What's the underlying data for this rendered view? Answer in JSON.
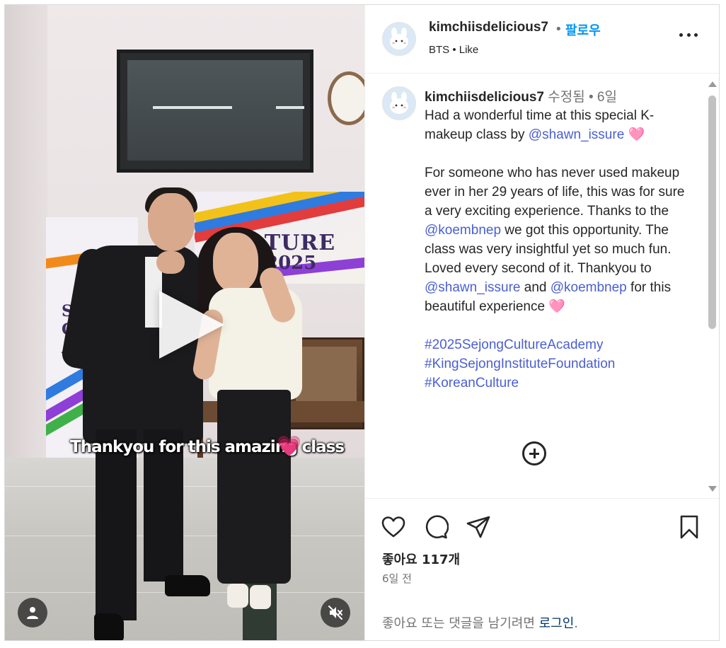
{
  "post": {
    "author": "kimchiisdelicious7",
    "follow_label": "팔로우",
    "subtitle": "BTS • Like",
    "video_caption": "Thankyou for this amazing class",
    "heart_emoji": "💗"
  },
  "comment": {
    "username": "kimchiisdelicious7",
    "meta": "수정됨 • 6일",
    "para1_text": "Had a wonderful time at this special K-makeup class by ",
    "para1_mention": "@shawn_issure",
    "para1_end": " 🩷",
    "para2_a": "For someone who has never used makeup ever in her 29 years of life, this was for sure a very exciting experience. Thanks to the ",
    "para2_mention1": "@koembnep",
    "para2_b": " we got this opportunity. The class was very insightful yet so much fun. Loved every second of it. Thankyou to ",
    "para2_mention2": "@shawn_issure",
    "para2_c": " and ",
    "para2_mention3": "@koembnep",
    "para2_d": " for this beautiful experience 🩷",
    "hashtags": [
      "#2025SejongCultureAcademy",
      "#KingSejongInstituteFoundation",
      "#KoreanCulture"
    ]
  },
  "footer": {
    "likes": "좋아요 117개",
    "time_ago": "6일 전",
    "login_prompt": "좋아요 또는 댓글을 남기려면 ",
    "login_link": "로그인",
    "login_suffix": "."
  },
  "icons": {
    "like": "heart-icon",
    "comment": "comment-icon",
    "share": "send-icon",
    "save": "bookmark-icon",
    "more": "more-icon",
    "add": "plus-circle-icon",
    "user": "user-icon",
    "mute": "muted-speaker-icon",
    "play": "play-icon"
  },
  "colors": {
    "accent": "#0095f6",
    "link": "#4a5fd1",
    "text": "#262626",
    "muted": "#737373"
  }
}
